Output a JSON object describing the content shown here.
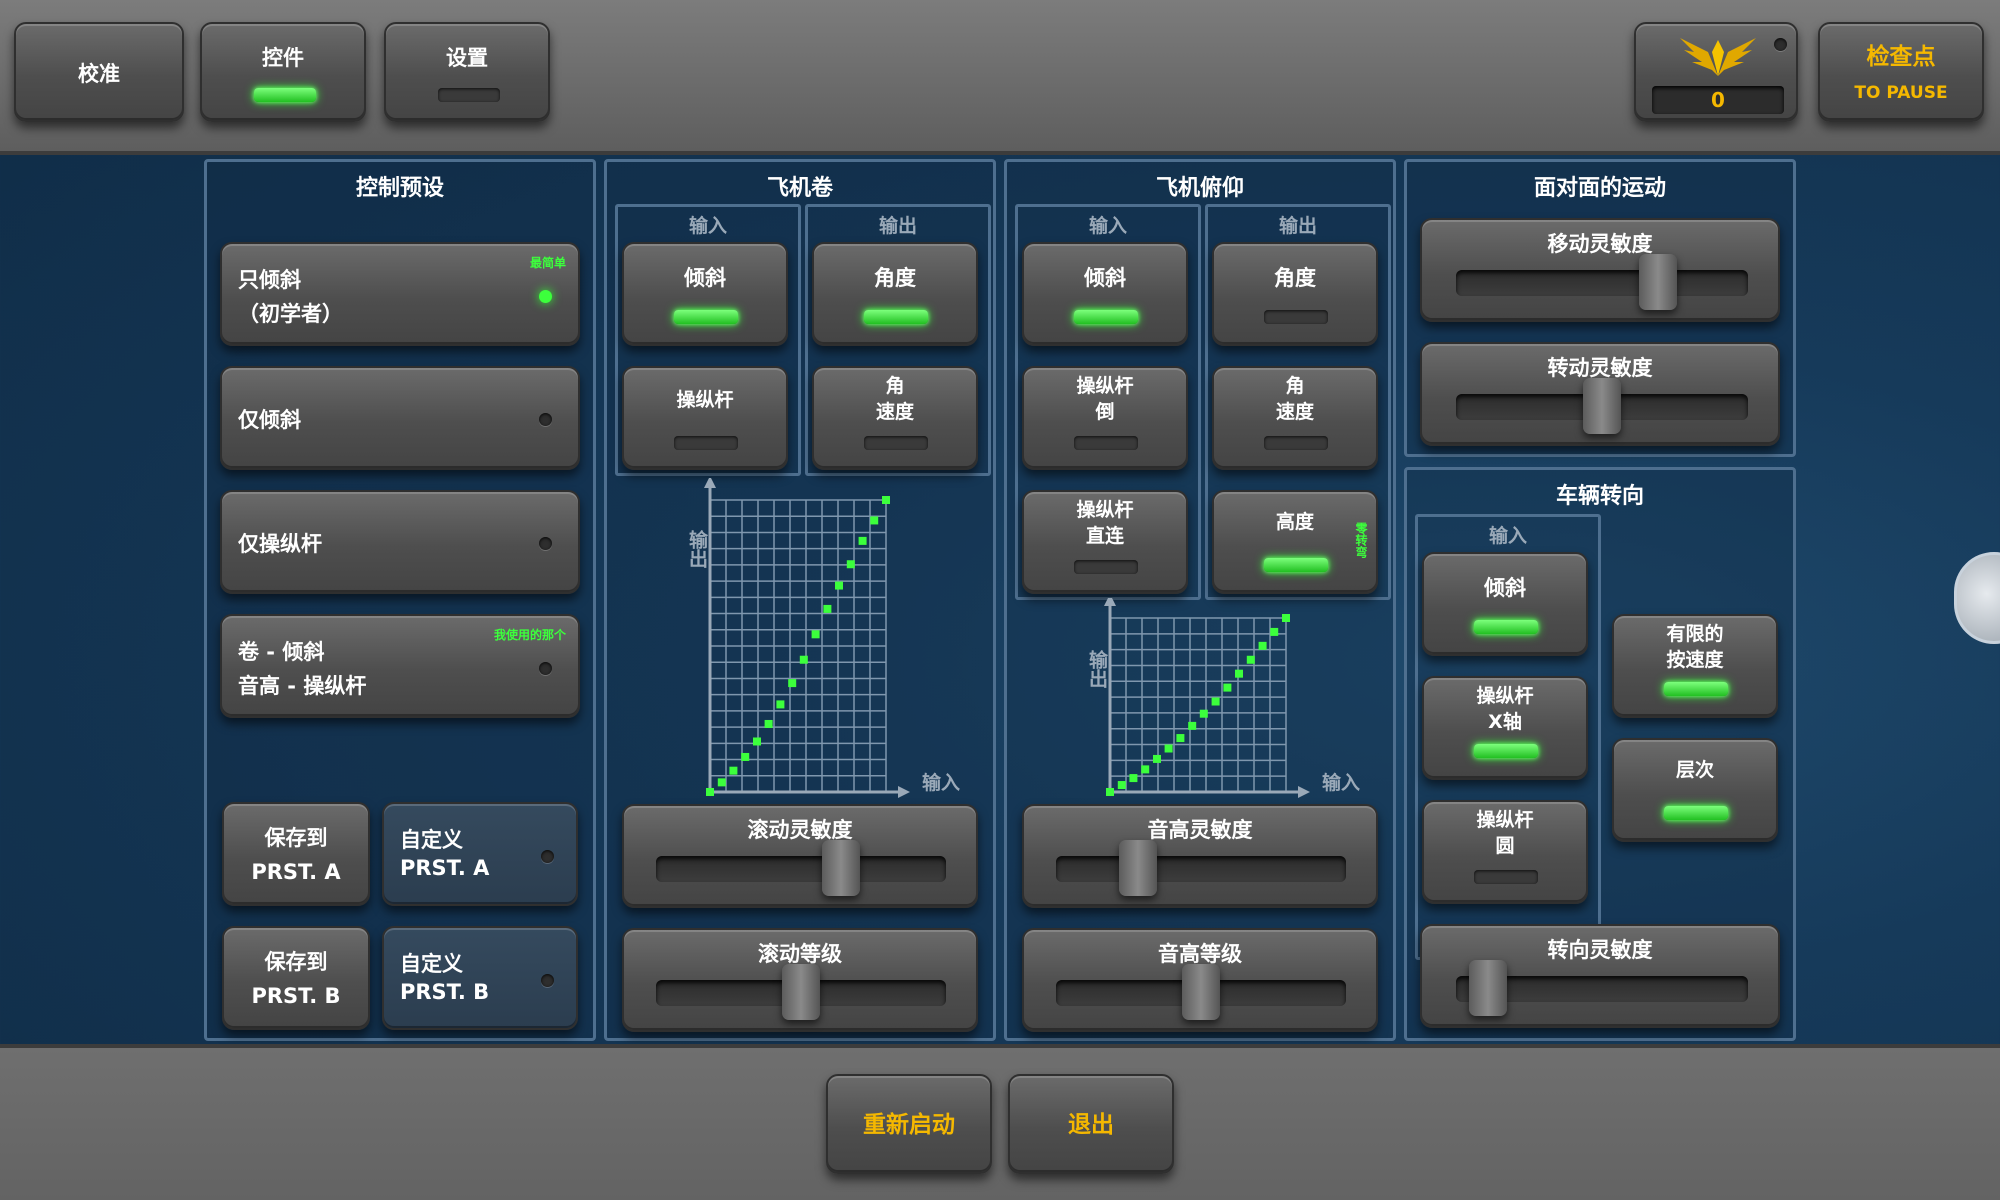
{
  "top": {
    "calibrate": "校准",
    "controls": "控件",
    "settings": "设置",
    "score": "0",
    "checkpoint": "检查点",
    "to_pause": "TO PAUSE"
  },
  "presets": {
    "title": "控制预设",
    "items": [
      {
        "line1": "只倾斜",
        "line2": "（初学者）",
        "tag": "最简单",
        "active": true
      },
      {
        "line1": "仅倾斜",
        "line2": "",
        "tag": "",
        "active": false
      },
      {
        "line1": "仅操纵杆",
        "line2": "",
        "tag": "",
        "active": false
      },
      {
        "line1": "卷 - 倾斜",
        "line2": "音高 - 操纵杆",
        "tag": "我使用的那个",
        "active": false
      }
    ],
    "save_a_1": "保存到",
    "save_a_2": "PRST. A",
    "custom_a_1": "自定义",
    "custom_a_2": "PRST. A",
    "save_b_1": "保存到",
    "save_b_2": "PRST. B",
    "custom_b_1": "自定义",
    "custom_b_2": "PRST. B"
  },
  "roll": {
    "title": "飞机卷",
    "input_label": "输入",
    "output_label": "输出",
    "in_tilt": "倾斜",
    "in_stick": "操纵杆",
    "out_angle": "角度",
    "out_rate_1": "角",
    "out_rate_2": "速度",
    "chart_y": "输出",
    "chart_x": "输入",
    "sens_label": "滚动灵敏度",
    "sens_value": 0.66,
    "level_label": "滚动等级",
    "level_value": 0.5
  },
  "pitch": {
    "title": "飞机俯仰",
    "input_label": "输入",
    "output_label": "输出",
    "in_tilt": "倾斜",
    "in_stick_inv_1": "操纵杆",
    "in_stick_inv_2": "倒",
    "in_stick_direct_1": "操纵杆",
    "in_stick_direct_2": "直连",
    "out_angle": "角度",
    "out_rate_1": "角",
    "out_rate_2": "速度",
    "out_altitude": "高度",
    "altitude_tag": "零转弯",
    "chart_y": "输出",
    "chart_x": "输入",
    "sens_label": "音高灵敏度",
    "sens_value": 0.25,
    "level_label": "音高等级",
    "level_value": 0.5
  },
  "motion": {
    "title": "面对面的运动",
    "move_label": "移动灵敏度",
    "move_value": 0.72,
    "turn_label": "转动灵敏度",
    "turn_value": 0.5
  },
  "steering": {
    "title": "车辆转向",
    "input_label": "输入",
    "tilt": "倾斜",
    "stick_x_1": "操纵杆",
    "stick_x_2": "X轴",
    "stick_round_1": "操纵杆",
    "stick_round_2": "圆",
    "limited_1": "有限的",
    "limited_2": "按速度",
    "layers": "层次",
    "sens_label": "转向灵敏度",
    "sens_value": 0.05
  },
  "bottom": {
    "restart": "重新启动",
    "exit": "退出"
  },
  "colors": {
    "accent_gold": "#f5b800",
    "indicator_green": "#3cff3c",
    "panel_border": "#4e6f8f"
  },
  "chart_data": [
    {
      "type": "scatter",
      "title": "",
      "xlabel": "输入",
      "ylabel": "输出",
      "x": [
        0,
        0.067,
        0.133,
        0.2,
        0.267,
        0.333,
        0.4,
        0.467,
        0.533,
        0.6,
        0.667,
        0.733,
        0.8,
        0.867,
        0.933,
        1.0
      ],
      "y": [
        0,
        0.033,
        0.073,
        0.12,
        0.173,
        0.233,
        0.3,
        0.373,
        0.453,
        0.54,
        0.627,
        0.707,
        0.78,
        0.86,
        0.93,
        1.0
      ]
    },
    {
      "type": "scatter",
      "title": "",
      "xlabel": "输入",
      "ylabel": "输出",
      "x": [
        0,
        0.067,
        0.133,
        0.2,
        0.267,
        0.333,
        0.4,
        0.467,
        0.533,
        0.6,
        0.667,
        0.733,
        0.8,
        0.867,
        0.933,
        1.0
      ],
      "y": [
        0,
        0.04,
        0.08,
        0.13,
        0.19,
        0.25,
        0.31,
        0.38,
        0.45,
        0.52,
        0.6,
        0.68,
        0.76,
        0.84,
        0.92,
        1.0
      ]
    }
  ]
}
